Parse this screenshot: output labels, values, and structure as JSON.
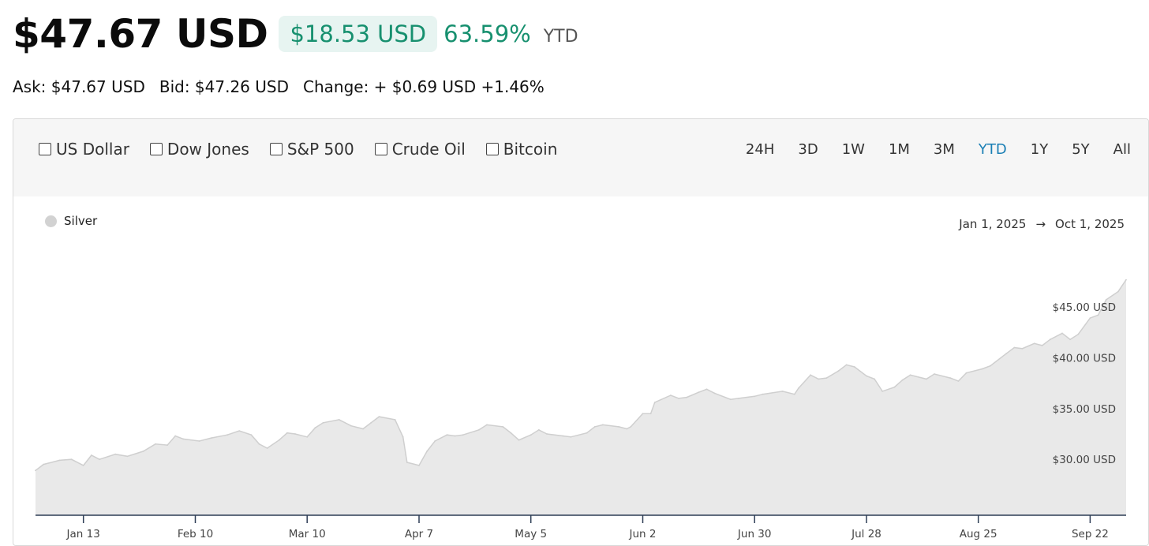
{
  "header": {
    "price": "$47.67 USD",
    "change_amount": "$18.53 USD",
    "change_pct": "63.59%",
    "period": "YTD"
  },
  "quote": {
    "ask": "Ask: $47.67 USD",
    "bid": "Bid: $47.26 USD",
    "change": "Change: + $0.69 USD +1.46%"
  },
  "compare": [
    "US Dollar",
    "Dow Jones",
    "S&P 500",
    "Crude Oil",
    "Bitcoin"
  ],
  "ranges": [
    "24H",
    "3D",
    "1W",
    "1M",
    "3M",
    "YTD",
    "1Y",
    "5Y",
    "All"
  ],
  "active_range": "YTD",
  "date_range": {
    "from": "Jan 1, 2025",
    "arrow": "→",
    "to": "Oct 1, 2025"
  },
  "colors": {
    "accent_green": "#17906f",
    "active_blue": "#1a7fb5",
    "area_fill": "#e9e9e9",
    "line": "#cfcfcf"
  },
  "chart_data": {
    "type": "area",
    "series": [
      {
        "name": "Silver",
        "points": [
          [
            "2025-01-01",
            28.9
          ],
          [
            "2025-01-03",
            29.5
          ],
          [
            "2025-01-07",
            29.9
          ],
          [
            "2025-01-10",
            30.0
          ],
          [
            "2025-01-13",
            29.4
          ],
          [
            "2025-01-15",
            30.4
          ],
          [
            "2025-01-17",
            30.0
          ],
          [
            "2025-01-21",
            30.5
          ],
          [
            "2025-01-24",
            30.3
          ],
          [
            "2025-01-28",
            30.8
          ],
          [
            "2025-01-31",
            31.5
          ],
          [
            "2025-02-03",
            31.4
          ],
          [
            "2025-02-05",
            32.3
          ],
          [
            "2025-02-07",
            32.0
          ],
          [
            "2025-02-11",
            31.8
          ],
          [
            "2025-02-14",
            32.1
          ],
          [
            "2025-02-18",
            32.4
          ],
          [
            "2025-02-21",
            32.8
          ],
          [
            "2025-02-24",
            32.4
          ],
          [
            "2025-02-26",
            31.5
          ],
          [
            "2025-02-28",
            31.1
          ],
          [
            "2025-03-03",
            31.9
          ],
          [
            "2025-03-05",
            32.6
          ],
          [
            "2025-03-07",
            32.5
          ],
          [
            "2025-03-10",
            32.2
          ],
          [
            "2025-03-12",
            33.1
          ],
          [
            "2025-03-14",
            33.6
          ],
          [
            "2025-03-18",
            33.9
          ],
          [
            "2025-03-21",
            33.3
          ],
          [
            "2025-03-24",
            33.0
          ],
          [
            "2025-03-26",
            33.6
          ],
          [
            "2025-03-28",
            34.2
          ],
          [
            "2025-04-01",
            33.9
          ],
          [
            "2025-04-03",
            32.2
          ],
          [
            "2025-04-04",
            29.7
          ],
          [
            "2025-04-07",
            29.4
          ],
          [
            "2025-04-09",
            30.8
          ],
          [
            "2025-04-11",
            31.8
          ],
          [
            "2025-04-14",
            32.4
          ],
          [
            "2025-04-16",
            32.3
          ],
          [
            "2025-04-18",
            32.4
          ],
          [
            "2025-04-22",
            32.9
          ],
          [
            "2025-04-24",
            33.4
          ],
          [
            "2025-04-28",
            33.2
          ],
          [
            "2025-04-30",
            32.6
          ],
          [
            "2025-05-02",
            31.9
          ],
          [
            "2025-05-05",
            32.4
          ],
          [
            "2025-05-07",
            32.9
          ],
          [
            "2025-05-09",
            32.5
          ],
          [
            "2025-05-13",
            32.3
          ],
          [
            "2025-05-15",
            32.2
          ],
          [
            "2025-05-19",
            32.6
          ],
          [
            "2025-05-21",
            33.2
          ],
          [
            "2025-05-23",
            33.4
          ],
          [
            "2025-05-27",
            33.2
          ],
          [
            "2025-05-29",
            33.0
          ],
          [
            "2025-05-30",
            33.2
          ],
          [
            "2025-06-02",
            34.5
          ],
          [
            "2025-06-04",
            34.5
          ],
          [
            "2025-06-05",
            35.6
          ],
          [
            "2025-06-09",
            36.3
          ],
          [
            "2025-06-11",
            36.0
          ],
          [
            "2025-06-13",
            36.1
          ],
          [
            "2025-06-16",
            36.6
          ],
          [
            "2025-06-18",
            36.9
          ],
          [
            "2025-06-20",
            36.5
          ],
          [
            "2025-06-24",
            35.9
          ],
          [
            "2025-06-26",
            36.0
          ],
          [
            "2025-06-30",
            36.2
          ],
          [
            "2025-07-02",
            36.4
          ],
          [
            "2025-07-07",
            36.7
          ],
          [
            "2025-07-10",
            36.4
          ],
          [
            "2025-07-11",
            37.0
          ],
          [
            "2025-07-14",
            38.3
          ],
          [
            "2025-07-16",
            37.9
          ],
          [
            "2025-07-18",
            38.0
          ],
          [
            "2025-07-21",
            38.7
          ],
          [
            "2025-07-23",
            39.3
          ],
          [
            "2025-07-25",
            39.1
          ],
          [
            "2025-07-28",
            38.2
          ],
          [
            "2025-07-30",
            37.9
          ],
          [
            "2025-08-01",
            36.7
          ],
          [
            "2025-08-04",
            37.1
          ],
          [
            "2025-08-06",
            37.8
          ],
          [
            "2025-08-08",
            38.3
          ],
          [
            "2025-08-12",
            37.9
          ],
          [
            "2025-08-14",
            38.4
          ],
          [
            "2025-08-18",
            38.0
          ],
          [
            "2025-08-20",
            37.7
          ],
          [
            "2025-08-22",
            38.5
          ],
          [
            "2025-08-26",
            38.9
          ],
          [
            "2025-08-28",
            39.2
          ],
          [
            "2025-09-01",
            40.4
          ],
          [
            "2025-09-03",
            41.0
          ],
          [
            "2025-09-05",
            40.9
          ],
          [
            "2025-09-08",
            41.4
          ],
          [
            "2025-09-10",
            41.2
          ],
          [
            "2025-09-12",
            41.8
          ],
          [
            "2025-09-15",
            42.4
          ],
          [
            "2025-09-17",
            41.8
          ],
          [
            "2025-09-19",
            42.3
          ],
          [
            "2025-09-22",
            43.9
          ],
          [
            "2025-09-24",
            44.2
          ],
          [
            "2025-09-26",
            45.7
          ],
          [
            "2025-09-29",
            46.5
          ],
          [
            "2025-10-01",
            47.67
          ]
        ]
      }
    ],
    "y_ticks": [
      {
        "value": 30,
        "label": "$30.00 USD"
      },
      {
        "value": 35,
        "label": "$35.00 USD"
      },
      {
        "value": 40,
        "label": "$40.00 USD"
      },
      {
        "value": 45,
        "label": "$45.00 USD"
      }
    ],
    "x_ticks": [
      "2025-01-13",
      "2025-02-10",
      "2025-03-10",
      "2025-04-07",
      "2025-05-05",
      "2025-06-02",
      "2025-06-30",
      "2025-07-28",
      "2025-08-25",
      "2025-09-22"
    ],
    "x_tick_labels": [
      "Jan 13",
      "Feb 10",
      "Mar 10",
      "Apr 7",
      "May 5",
      "Jun 2",
      "Jun 30",
      "Jul 28",
      "Aug 25",
      "Sep 22"
    ],
    "xlim": [
      "2025-01-01",
      "2025-10-01"
    ],
    "ylim": [
      24.5,
      49.5
    ],
    "grid": false
  }
}
